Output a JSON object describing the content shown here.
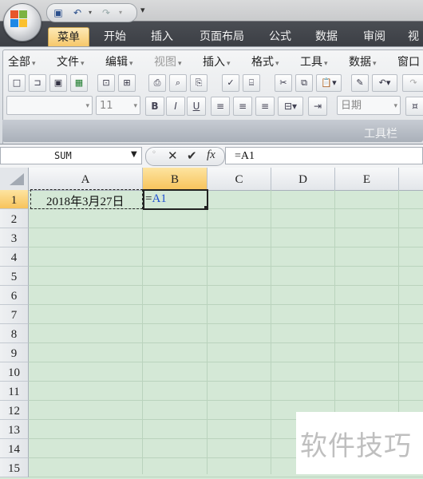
{
  "quick_access": {
    "save_icon": "save-icon",
    "undo_icon": "undo-icon",
    "redo_icon": "redo-icon",
    "more": "▾"
  },
  "tabs": [
    "菜单",
    "开始",
    "插入",
    "页面布局",
    "公式",
    "数据",
    "审阅",
    "视"
  ],
  "active_tab": "菜单",
  "menu": [
    "全部",
    "文件",
    "编辑",
    "视图",
    "插入",
    "格式",
    "工具",
    "数据",
    "窗口"
  ],
  "menu_disabled": [
    "视图"
  ],
  "font_combo": "",
  "size_combo": "11",
  "format_combo": "日期",
  "format_buttons": [
    "B",
    "I",
    "U"
  ],
  "toolbar_label": "工具栏",
  "formula_bar": {
    "name_box": "SUM",
    "cancel": "✕",
    "enter": "✔",
    "fx": "fx",
    "formula": "=A1"
  },
  "columns": [
    "A",
    "B",
    "C",
    "D",
    "E"
  ],
  "selected_column": "B",
  "rows": [
    "1",
    "2",
    "3",
    "4",
    "5",
    "6",
    "7",
    "8",
    "9",
    "10",
    "11",
    "12",
    "13",
    "14",
    "15"
  ],
  "cells": {
    "A1": "2018年3月27日",
    "B1_prefix": "=",
    "B1_ref": "A1"
  },
  "watermark": "软件技巧",
  "colors": {
    "grid_bg": "#d4e8d6",
    "selected_header": "#f7c35b",
    "reference_blue": "#1f4fd1"
  }
}
